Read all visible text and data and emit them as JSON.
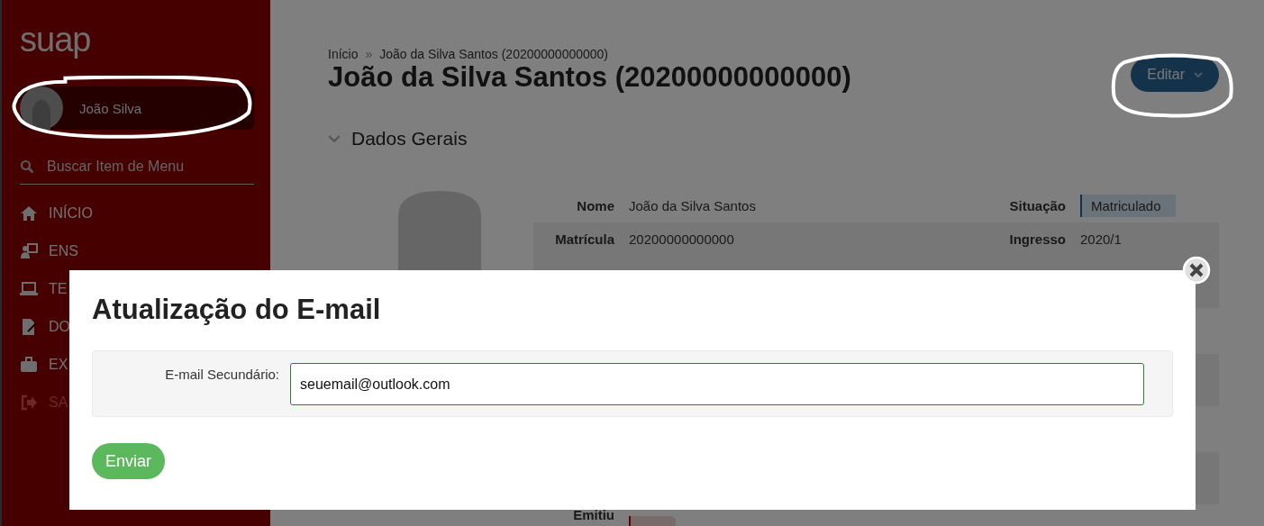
{
  "sidebar": {
    "logo": "suap",
    "user": {
      "name": "João Silva"
    },
    "search": {
      "placeholder": "Buscar Item de Menu"
    },
    "menu": [
      {
        "label": "INÍCIO",
        "kind": "link"
      },
      {
        "label": "ENS",
        "kind": "link"
      },
      {
        "label": "TE",
        "kind": "link"
      },
      {
        "label": "DO",
        "kind": "link"
      },
      {
        "label": "EX",
        "kind": "link"
      },
      {
        "label": "SA",
        "kind": "exit"
      }
    ]
  },
  "main": {
    "breadcrumb_separator": "»",
    "breadcrumb": [
      "Início",
      "João da Silva Santos (20200000000000)"
    ],
    "title": "João da Silva Santos (20200000000000)",
    "edit_button": "Editar",
    "section": {
      "title": "Dados Gerais",
      "expanded": true
    },
    "rows": [
      {
        "label": "Nome",
        "value": "João da Silva Santos",
        "label_2": "Situação",
        "badge": "Matriculado"
      },
      {
        "label": "Matrícula",
        "value": "20200000000000",
        "label_2": "Ingresso",
        "value_2": "2020/1"
      }
    ],
    "footer_label": "Emitiu"
  },
  "modal": {
    "title": "Atualização do E-mail",
    "field": {
      "label": "E-mail Secundário:",
      "value": "seuemail@outlook.com"
    },
    "submit": "Enviar"
  }
}
